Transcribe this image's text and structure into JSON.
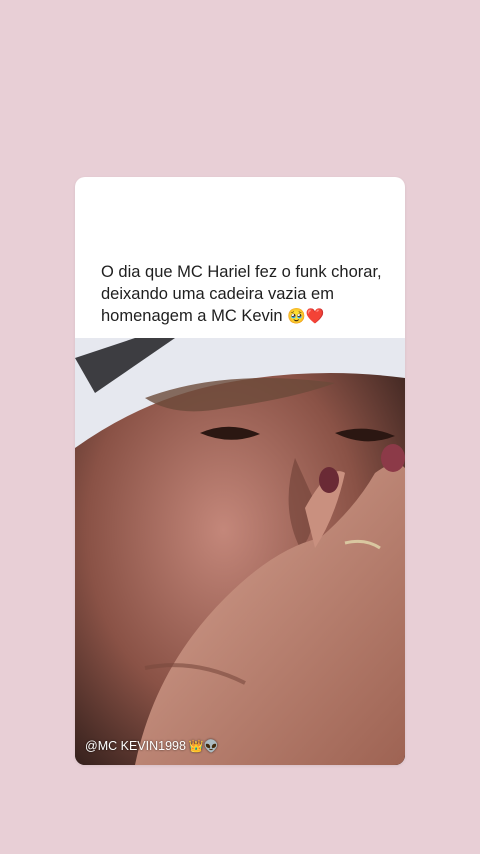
{
  "post": {
    "caption": "O dia que MC Hariel fez o funk chorar, deixando uma cadeira vazia em homenagem a MC Kevin",
    "caption_emojis": "🥹❤️",
    "media_icon": "photo-crying-woman",
    "watermark": {
      "handle": "@MC KEVIN1998",
      "badges": "👑👽"
    }
  },
  "colors": {
    "background": "#e8cfd6",
    "card": "#ffffff",
    "text": "#1f1f1f"
  }
}
